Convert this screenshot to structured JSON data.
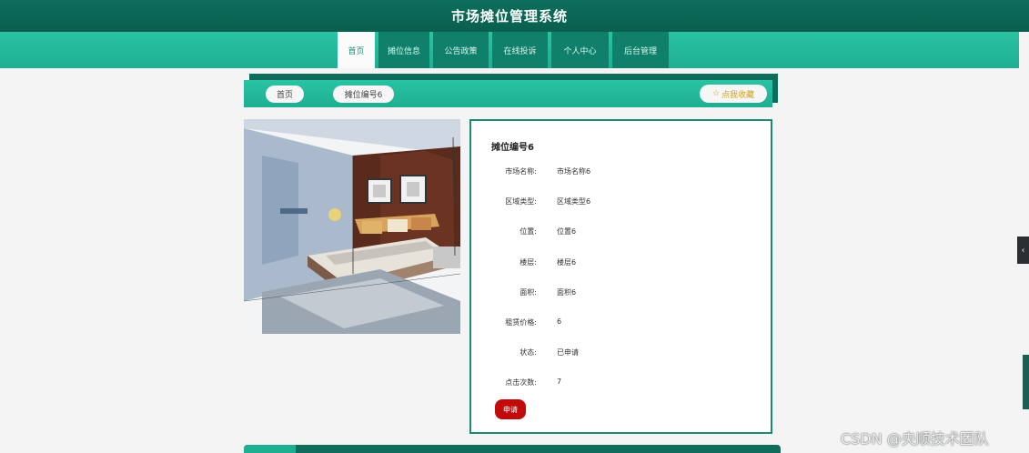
{
  "header": {
    "title": "市场摊位管理系统"
  },
  "nav": {
    "items": [
      {
        "label": "首页",
        "active": true
      },
      {
        "label": "摊位信息",
        "active": false
      },
      {
        "label": "公告政策",
        "active": false
      },
      {
        "label": "在线投诉",
        "active": false
      },
      {
        "label": "个人中心",
        "active": false
      },
      {
        "label": "后台管理",
        "active": false
      }
    ]
  },
  "breadcrumb": {
    "items": [
      "首页",
      "摊位编号6"
    ],
    "favorite_label": "点我收藏",
    "favorite_icon": "star-icon"
  },
  "detail": {
    "title": "摊位编号6",
    "fields": [
      {
        "label": "市场名称:",
        "value": "市场名称6"
      },
      {
        "label": "区域类型:",
        "value": "区域类型6"
      },
      {
        "label": "位置:",
        "value": "位置6"
      },
      {
        "label": "楼层:",
        "value": "楼层6"
      },
      {
        "label": "面积:",
        "value": "面积6"
      },
      {
        "label": "租赁价格:",
        "value": "6"
      },
      {
        "label": "状态:",
        "value": "已申请"
      },
      {
        "label": "点击次数:",
        "value": "7"
      }
    ],
    "apply_label": "申请"
  },
  "colors": {
    "primary": "#1eaf92",
    "dark": "#0f6c5b",
    "apply": "#c10a0a",
    "favorite": "#c9a323"
  },
  "watermark": "CSDN @央顺技术团队"
}
